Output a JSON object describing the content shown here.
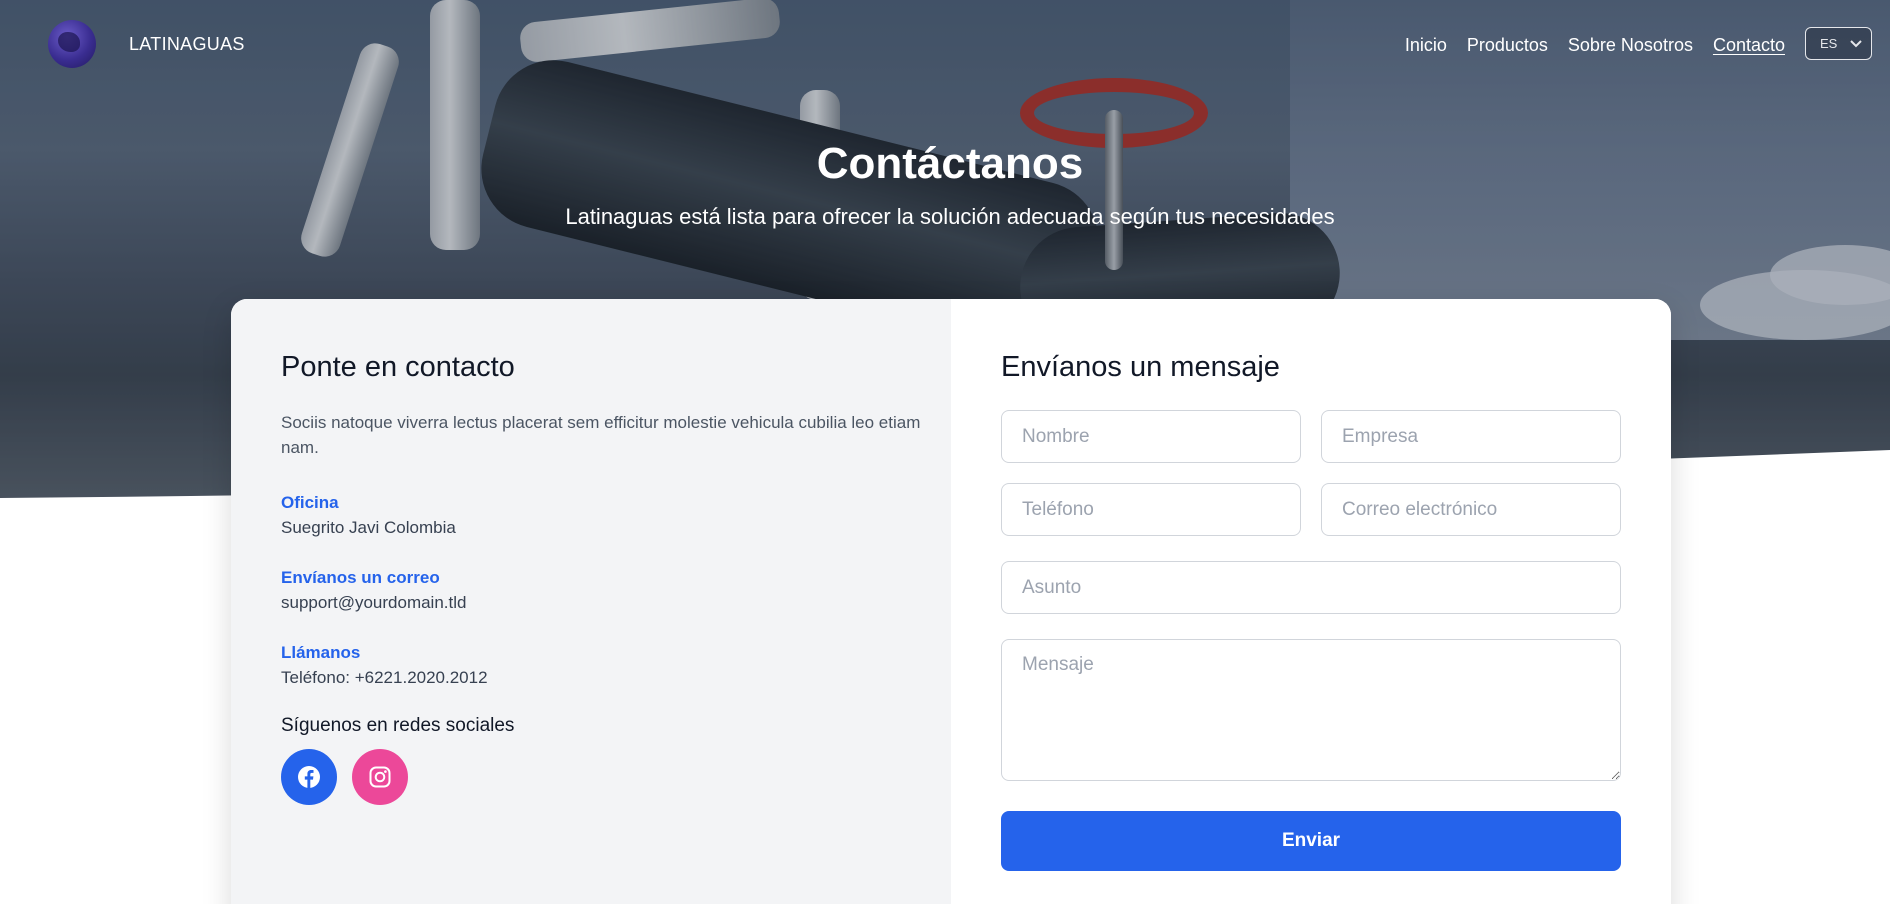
{
  "nav": {
    "brand": "LATINAGUAS",
    "links": [
      {
        "label": "Inicio"
      },
      {
        "label": "Productos"
      },
      {
        "label": "Sobre Nosotros"
      },
      {
        "label": "Contacto",
        "active": true
      }
    ],
    "language": "ES"
  },
  "hero": {
    "title": "Contáctanos",
    "subtitle": "Latinaguas está lista para ofrecer la solución adecuada según tus necesidades"
  },
  "contact_info": {
    "title": "Ponte en contacto",
    "intro": "Sociis natoque viverra lectus placerat sem efficitur molestie vehicula cubilia leo etiam nam.",
    "office_label": "Oficina",
    "office_value": "Suegrito Javi Colombia",
    "email_label": "Envíanos un correo",
    "email_value": "support@yourdomain.tld",
    "phone_label": "Llámanos",
    "phone_value": "Teléfono: +6221.2020.2012",
    "social_title": "Síguenos en redes sociales",
    "social": [
      "facebook-icon",
      "instagram-icon"
    ]
  },
  "form": {
    "title": "Envíanos un mensaje",
    "name_placeholder": "Nombre",
    "company_placeholder": "Empresa",
    "phone_placeholder": "Teléfono",
    "email_placeholder": "Correo electrónico",
    "subject_placeholder": "Asunto",
    "message_placeholder": "Mensaje",
    "submit_label": "Enviar"
  },
  "colors": {
    "accent": "#2563eb",
    "instagram": "#ec4899",
    "panel": "#f3f4f6"
  }
}
